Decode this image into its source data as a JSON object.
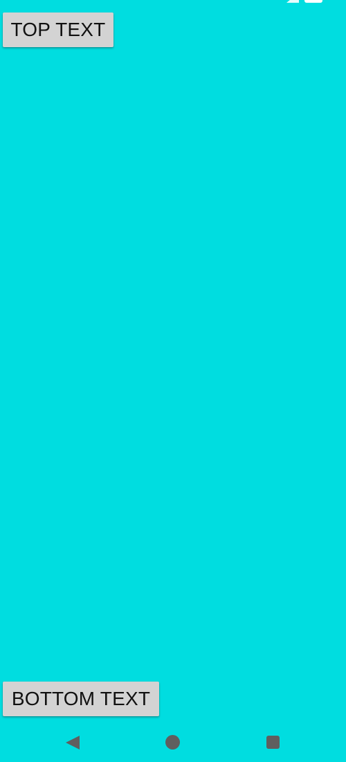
{
  "theme": {
    "background": "#00dde0",
    "button_bg": "#d3d3d3",
    "nav_icon_color": "#5f5f5f"
  },
  "status_bar": {
    "icons": [
      "wifi-icon",
      "signal-icon",
      "battery-icon"
    ]
  },
  "buttons": {
    "top_label": "TOP TEXT",
    "bottom_label": "BOTTOM TEXT"
  },
  "nav_bar": {
    "icons": [
      "back-icon",
      "home-icon",
      "recents-icon"
    ]
  }
}
